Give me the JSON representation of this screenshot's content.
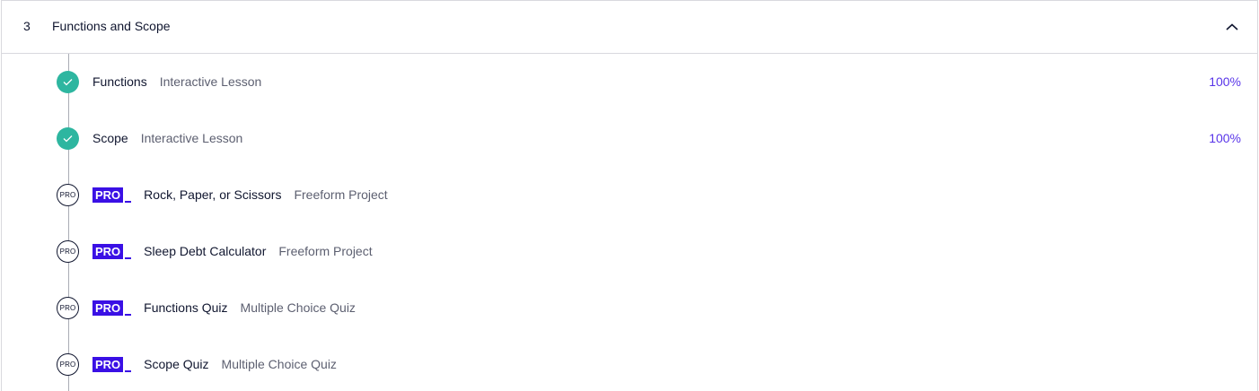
{
  "module": {
    "number": "3",
    "title": "Functions and Scope",
    "toggle_icon": "chevron-up-icon"
  },
  "lessons": [
    {
      "status": "complete",
      "status_icon": "check-icon",
      "title": "Functions",
      "type": "Interactive Lesson",
      "progress": "100%",
      "pro": false
    },
    {
      "status": "complete",
      "status_icon": "check-icon",
      "title": "Scope",
      "type": "Interactive Lesson",
      "progress": "100%",
      "pro": false
    },
    {
      "status": "locked",
      "status_icon": "pro-lock-icon",
      "status_label": "PRO",
      "badge": "PRO",
      "title": "Rock, Paper, or Scissors",
      "type": "Freeform Project",
      "pro": true
    },
    {
      "status": "locked",
      "status_icon": "pro-lock-icon",
      "status_label": "PRO",
      "badge": "PRO",
      "title": "Sleep Debt Calculator",
      "type": "Freeform Project",
      "pro": true
    },
    {
      "status": "locked",
      "status_icon": "pro-lock-icon",
      "status_label": "PRO",
      "badge": "PRO",
      "title": "Functions Quiz",
      "type": "Multiple Choice Quiz",
      "pro": true
    },
    {
      "status": "locked",
      "status_icon": "pro-lock-icon",
      "status_label": "PRO",
      "badge": "PRO",
      "title": "Scope Quiz",
      "type": "Multiple Choice Quiz",
      "pro": true
    }
  ],
  "colors": {
    "complete": "#2eb6a0",
    "pro_accent": "#3a10e5",
    "text_primary": "#10162f",
    "text_secondary": "#5c5f70",
    "border": "#d9d9de"
  }
}
